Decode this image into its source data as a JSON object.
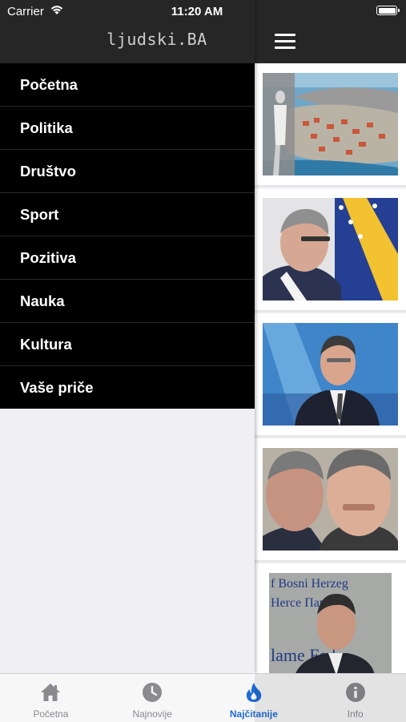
{
  "status_bar": {
    "carrier": "Carrier",
    "time": "11:20 AM"
  },
  "header": {
    "logo_text": "ljudski.BA"
  },
  "menu": {
    "items": [
      {
        "label": "Početna"
      },
      {
        "label": "Politika"
      },
      {
        "label": "Društvo"
      },
      {
        "label": "Sport"
      },
      {
        "label": "Pozitiva"
      },
      {
        "label": "Nauka"
      },
      {
        "label": "Kultura"
      },
      {
        "label": "Vaše priče"
      }
    ]
  },
  "tabs": [
    {
      "label": "Početna",
      "icon": "home-icon",
      "active": false
    },
    {
      "label": "Najnovije",
      "icon": "clock-icon",
      "active": false
    },
    {
      "label": "Najčitanije",
      "icon": "flame-icon",
      "active": true
    },
    {
      "label": "Info",
      "icon": "info-icon",
      "active": false
    }
  ],
  "colors": {
    "header_bg": "#262626",
    "menu_bg": "#000000",
    "active_tab": "#1f6cd6",
    "inactive_tab": "#8a8a8f"
  }
}
